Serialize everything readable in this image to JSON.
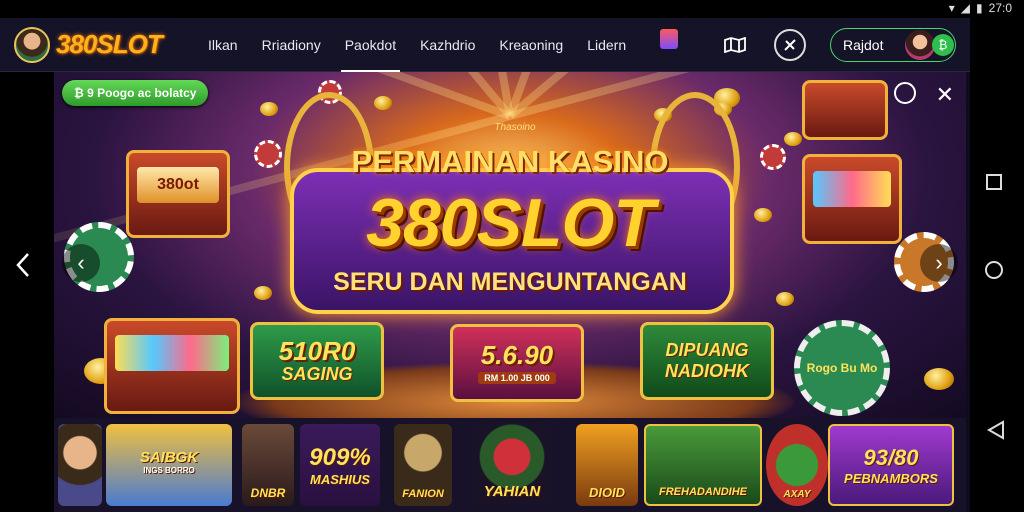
{
  "status_bar": {
    "time": "27:0"
  },
  "brand": {
    "name": "380SLOT"
  },
  "nav": {
    "items": [
      {
        "label": "Ilkan",
        "active": false
      },
      {
        "label": "Rriadiony",
        "active": false
      },
      {
        "label": "Paokdot",
        "active": true
      },
      {
        "label": "Kazhdrio",
        "active": false
      },
      {
        "label": "Kreaoning",
        "active": false
      },
      {
        "label": "Lidern",
        "active": false
      }
    ],
    "account_label": "Rajdot",
    "account_badge": "₿"
  },
  "banner": {
    "promo_badge": "₿ 9 Poogo ac bolatcy",
    "crest_text": "Thasoino",
    "title_top": "PERMAINAN KASINO",
    "title_main": "380SLOT",
    "title_sub": "SERU DAN MENGUNTANGAN",
    "left_slot_text": "380ot",
    "prizes": [
      {
        "big": "510R0",
        "small": "SAGING",
        "tag": ""
      },
      {
        "big": "5.6.90",
        "small": "",
        "tag": "RM 1.00 JB 000"
      },
      {
        "big": "DIPUANG",
        "small": "NADIOHK",
        "tag": ""
      }
    ],
    "chip_text": "Rogo Bu Mo",
    "prev_label": "‹",
    "next_label": "›",
    "close_label": "✕"
  },
  "games": [
    {
      "label": "SAIBGK",
      "sub": "INGS BORRO"
    },
    {
      "label": "DNBR",
      "sub": ""
    },
    {
      "label": "909%",
      "sub": "MASHIUS"
    },
    {
      "label": "FANION",
      "sub": ""
    },
    {
      "label": "YAHIAN",
      "sub": ""
    },
    {
      "label": "DIOID",
      "sub": ""
    },
    {
      "label": "FREHADANDIHE",
      "sub": ""
    },
    {
      "label": "AXAY",
      "sub": ""
    },
    {
      "label": "93/80",
      "sub": "PEBNAMBORS"
    }
  ],
  "colors": {
    "accent": "#ffd22e",
    "green": "#4bd56e",
    "nav_bg": "#141327"
  }
}
